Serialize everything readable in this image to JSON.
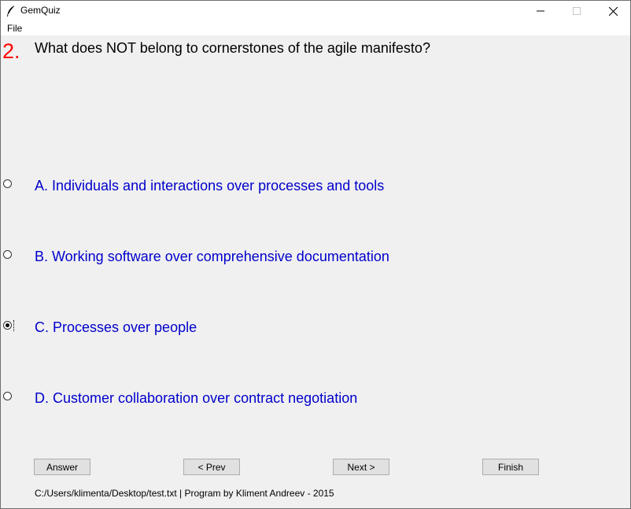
{
  "window": {
    "title": "GemQuiz",
    "icon": "feather-icon",
    "controls": [
      "minimize-icon",
      "maximize-icon",
      "close-icon"
    ]
  },
  "menu": {
    "items": [
      "File"
    ]
  },
  "question": {
    "number": "2.",
    "text": "What does NOT belong to cornerstones of the agile manifesto?"
  },
  "options": [
    {
      "label": "A. Individuals and interactions over processes and tools",
      "checked": false
    },
    {
      "label": "B. Working software over comprehensive documentation",
      "checked": false
    },
    {
      "label": "C. Processes over people",
      "checked": true
    },
    {
      "label": "D. Customer collaboration over contract negotiation",
      "checked": false
    }
  ],
  "buttons": {
    "answer": "Answer",
    "prev": "< Prev",
    "next": "Next >",
    "finish": "Finish"
  },
  "status": "C:/Users/klimenta/Desktop/test.txt | Program by Kliment Andreev - 2015",
  "colors": {
    "question_number": "#ff0000",
    "option_text": "#0000cc",
    "background": "#f0f0f0"
  }
}
